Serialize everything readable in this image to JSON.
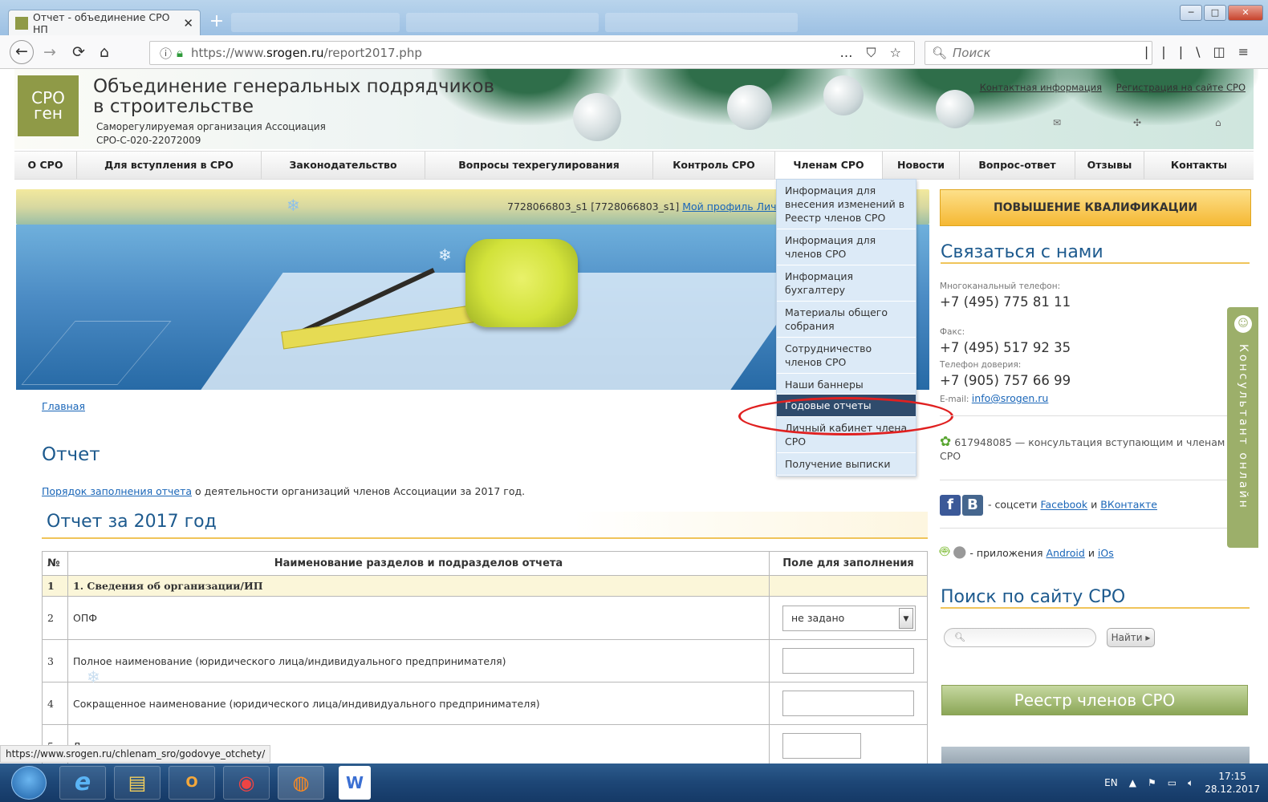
{
  "browser": {
    "tab_title": "Отчет - объединение СРО НП",
    "tab_close": "✕",
    "new_tab": "+",
    "url_prefix": "https://www.",
    "url_host": "srogen.ru",
    "url_path": "/report2017.php",
    "url_actions": "… ⛉ ☆",
    "search_placeholder": "Поиск",
    "back": "←",
    "forward": "→",
    "reload": "⟳",
    "home": "⌂",
    "library": "|||\\",
    "sidebar": "◫",
    "menu": "≡",
    "minimize": "─",
    "maximize": "□",
    "close": "✕"
  },
  "header": {
    "logo_top": "СРО",
    "logo_bottom": "ген",
    "title_line1": "Объединение генеральных подрядчиков",
    "title_line2": "в строительстве",
    "subtitle_line1": "Саморегулируемая организация Ассоциация",
    "subtitle_line2": "СРО-С-020-22072009",
    "link_contacts": "Контактная информация",
    "link_register": "Регистрация на сайте СРО"
  },
  "menu": [
    "О СРО",
    "Для вступления в СРО",
    "Законодательство",
    "Вопросы техрегулирования",
    "Контроль СРО",
    "Членам СРО",
    "Новости",
    "Вопрос-ответ",
    "Отзывы",
    "Контакты"
  ],
  "userbar": {
    "user": "7728066803_s1 [7728066803_s1]",
    "profile_link": "Мой профиль Лич"
  },
  "dropdown": [
    "Информация для внесения изменений в Реестр членов СРО",
    "Информация для членов СРО",
    "Информация бухгалтеру",
    "Материалы общего собрания",
    "Сотрудничество членов СРО",
    "Наши баннеры",
    "Годовые отчеты",
    "Личный кабинет члена СРО",
    "Получение выписки"
  ],
  "dropdown_selected": "Годовые отчеты",
  "content": {
    "breadcrumb": "Главная",
    "page_title": "Отчет",
    "intro_link": "Порядок заполнения отчета",
    "intro_text": " о деятельности организаций членов Ассоциации за 2017 год.",
    "report_heading": "Отчет за 2017 год"
  },
  "table": {
    "headers": [
      "№",
      "Наименование разделов и подразделов отчета",
      "Поле для заполнения"
    ],
    "section1": {
      "num": "1",
      "title": "1. Сведения об организации/ИП"
    },
    "rows": [
      {
        "num": "2",
        "title": "ОПФ",
        "select_value": "не задано"
      },
      {
        "num": "3",
        "title": "Полное наименование (юридического лица/индивидуального предпринимателя)"
      },
      {
        "num": "4",
        "title": "Сокращенное наименование (юридического лица/индивидуального предпринимателя)"
      },
      {
        "num": "5",
        "title": "Д"
      }
    ]
  },
  "sidebar": {
    "qual_button": "ПОВЫШЕНИЕ КВАЛИФИКАЦИИ",
    "contact_title": "Связаться с нами",
    "phone_label": "Многоканальный телефон:",
    "phone": "+7 (495) 775 81 11",
    "fax_label": "Факс:",
    "fax": "+7 (495) 517 92 35",
    "trust_label": "Телефон доверия:",
    "trust": "+7 (905) 757 66 99",
    "email_label": "E-mail: ",
    "email": "info@srogen.ru",
    "icq_text": "617948085 — консультация вступающим и членам",
    "icq_text2": "СРО",
    "social_prefix": " - соцсети ",
    "social_fb": "Facebook",
    "social_and": " и ",
    "social_vk": "ВКонтакте",
    "apps_prefix": " - приложения ",
    "apps_android": "Android",
    "apps_and": " и ",
    "apps_ios": "iOs",
    "search_title": "Поиск по сайту СРО",
    "search_placeholder": "",
    "find_button": "Найти",
    "registry_button": "Реестр членов СРО",
    "consult_text": "Консультант онлайн"
  },
  "status_url": "https://www.srogen.ru/chlenam_sro/godovye_otchety/",
  "tray": {
    "lang": "EN",
    "time": "17:15",
    "date": "28.12.2017"
  }
}
